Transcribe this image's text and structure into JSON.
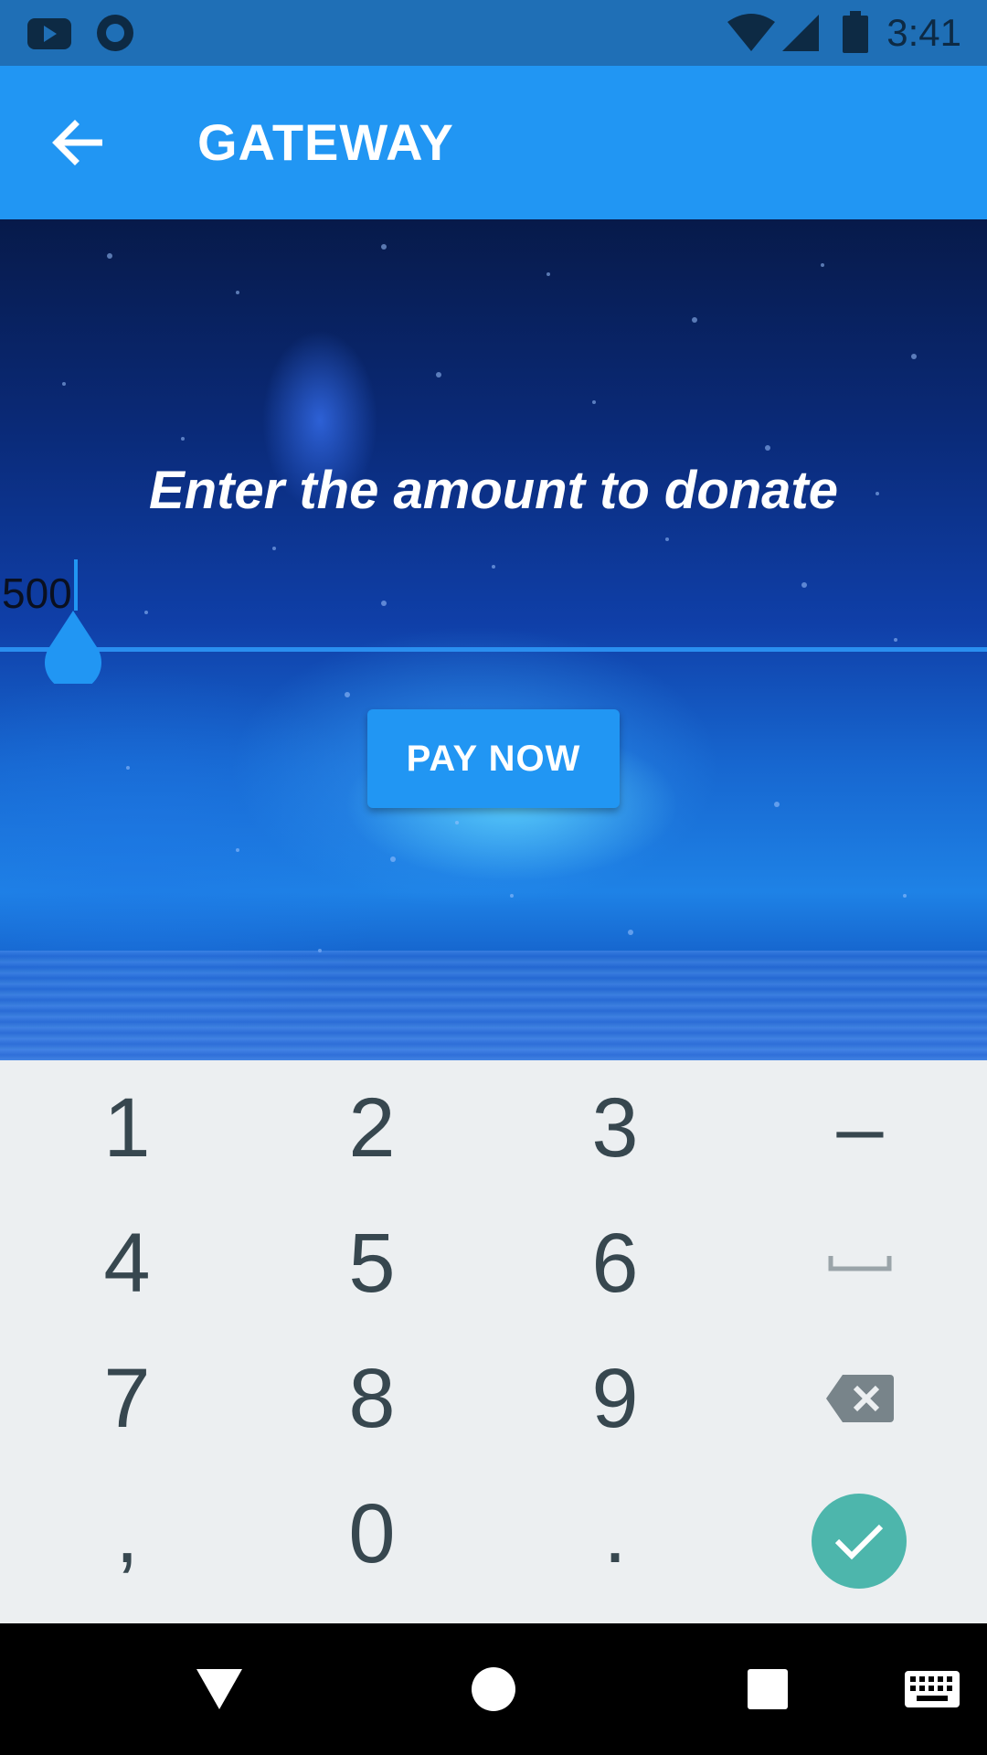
{
  "status_bar": {
    "time": "3:41",
    "left_icons": [
      "youtube-icon",
      "circle-icon"
    ],
    "right_icons": [
      "wifi-icon",
      "cell-signal-icon",
      "battery-icon"
    ]
  },
  "app_bar": {
    "title": "GATEWAY",
    "back_icon": "arrow-back-icon"
  },
  "main": {
    "prompt": "Enter the amount to donate",
    "amount_value": "500",
    "pay_button_label": "PAY NOW"
  },
  "keypad": {
    "rows": [
      [
        "1",
        "2",
        "3",
        "–"
      ],
      [
        "4",
        "5",
        "6",
        "space"
      ],
      [
        "7",
        "8",
        "9",
        "backspace"
      ],
      [
        ",",
        "0",
        ".",
        "done"
      ]
    ],
    "done_color": "#4db6ac"
  },
  "nav_bar": {
    "icons": [
      "back-triangle-icon",
      "home-circle-icon",
      "recents-square-icon",
      "keyboard-icon"
    ]
  },
  "colors": {
    "primary": "#2196f3",
    "status_bar": "#1f6fb6",
    "keypad_bg": "#eceff1",
    "key_text": "#37474f"
  }
}
